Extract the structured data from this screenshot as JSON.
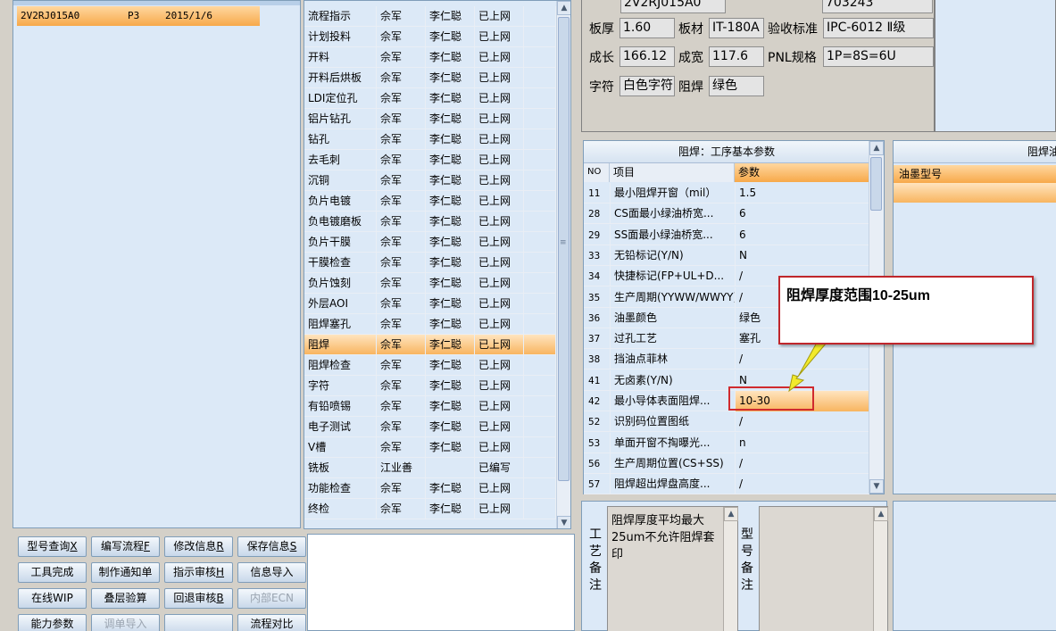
{
  "left_panel": {
    "row": {
      "code": "2V2RJ015A0",
      "col2": "P3",
      "date": "2015/1/6"
    }
  },
  "buttons": [
    {
      "label": "型号查询",
      "key": "X",
      "enabled": true
    },
    {
      "label": "编写流程",
      "key": "F",
      "enabled": true
    },
    {
      "label": "修改信息",
      "key": "R",
      "enabled": true
    },
    {
      "label": "保存信息",
      "key": "S",
      "enabled": true
    },
    {
      "label": "工具完成",
      "key": "",
      "enabled": true
    },
    {
      "label": "制作通知单",
      "key": "",
      "enabled": true
    },
    {
      "label": "指示审核",
      "key": "H",
      "enabled": true
    },
    {
      "label": "信息导入",
      "key": "",
      "enabled": true
    },
    {
      "label": "在线WIP",
      "key": "",
      "enabled": true
    },
    {
      "label": "叠层验算",
      "key": "",
      "enabled": true
    },
    {
      "label": "回退审核",
      "key": "B",
      "enabled": true
    },
    {
      "label": "内部ECN",
      "key": "",
      "enabled": false
    },
    {
      "label": "能力参数",
      "key": "",
      "enabled": true
    },
    {
      "label": "调单导入",
      "key": "",
      "enabled": false
    },
    {
      "label": "",
      "key": "",
      "enabled": true
    },
    {
      "label": "流程对比",
      "key": "",
      "enabled": true
    }
  ],
  "process_list": {
    "rows": [
      {
        "step": "流程指示",
        "c2": "佘军",
        "c3": "李仁聪",
        "c4": "已上网"
      },
      {
        "step": "计划投料",
        "c2": "佘军",
        "c3": "李仁聪",
        "c4": "已上网"
      },
      {
        "step": "开料",
        "c2": "佘军",
        "c3": "李仁聪",
        "c4": "已上网"
      },
      {
        "step": "开料后烘板",
        "c2": "佘军",
        "c3": "李仁聪",
        "c4": "已上网"
      },
      {
        "step": "LDI定位孔",
        "c2": "佘军",
        "c3": "李仁聪",
        "c4": "已上网"
      },
      {
        "step": "铝片钻孔",
        "c2": "佘军",
        "c3": "李仁聪",
        "c4": "已上网"
      },
      {
        "step": "钻孔",
        "c2": "佘军",
        "c3": "李仁聪",
        "c4": "已上网"
      },
      {
        "step": "去毛刺",
        "c2": "佘军",
        "c3": "李仁聪",
        "c4": "已上网"
      },
      {
        "step": "沉铜",
        "c2": "佘军",
        "c3": "李仁聪",
        "c4": "已上网"
      },
      {
        "step": "负片电镀",
        "c2": "佘军",
        "c3": "李仁聪",
        "c4": "已上网"
      },
      {
        "step": "负电镀磨板",
        "c2": "佘军",
        "c3": "李仁聪",
        "c4": "已上网"
      },
      {
        "step": "负片干膜",
        "c2": "佘军",
        "c3": "李仁聪",
        "c4": "已上网"
      },
      {
        "step": "干膜检查",
        "c2": "佘军",
        "c3": "李仁聪",
        "c4": "已上网"
      },
      {
        "step": "负片蚀刻",
        "c2": "佘军",
        "c3": "李仁聪",
        "c4": "已上网"
      },
      {
        "step": "外层AOI",
        "c2": "佘军",
        "c3": "李仁聪",
        "c4": "已上网"
      },
      {
        "step": "阻焊塞孔",
        "c2": "佘军",
        "c3": "李仁聪",
        "c4": "已上网"
      },
      {
        "step": "阻焊",
        "c2": "佘军",
        "c3": "李仁聪",
        "c4": "已上网",
        "selected": true
      },
      {
        "step": "阻焊检查",
        "c2": "佘军",
        "c3": "李仁聪",
        "c4": "已上网"
      },
      {
        "step": "字符",
        "c2": "佘军",
        "c3": "李仁聪",
        "c4": "已上网"
      },
      {
        "step": "有铅喷锡",
        "c2": "佘军",
        "c3": "李仁聪",
        "c4": "已上网"
      },
      {
        "step": "电子测试",
        "c2": "佘军",
        "c3": "李仁聪",
        "c4": "已上网"
      },
      {
        "step": "V槽",
        "c2": "佘军",
        "c3": "李仁聪",
        "c4": "已上网"
      },
      {
        "step": "铣板",
        "c2": "江业善",
        "c3": "",
        "c4": "已编写"
      },
      {
        "step": "功能检查",
        "c2": "佘军",
        "c3": "李仁聪",
        "c4": "已上网"
      },
      {
        "step": "终检",
        "c2": "佘军",
        "c3": "李仁聪",
        "c4": "已上网"
      }
    ]
  },
  "info": {
    "top_value": "2V2RJ015A0",
    "top_value2": "703243",
    "thickness_label": "板厚",
    "thickness": "1.60",
    "material_label": "板材",
    "material": "IT-180A",
    "standard_label": "验收标准",
    "standard": "IPC-6012 Ⅱ级",
    "length_label": "成长",
    "length": "166.12",
    "width_label": "成宽",
    "width": "117.6",
    "pnl_label": "PNL规格",
    "pnl": "1P=8S=6U",
    "char_label": "字符",
    "char_color": "白色字符",
    "mask_label": "阻焊",
    "mask_color": "绿色"
  },
  "params": {
    "title": "阻焊：工序基本参数",
    "headers": {
      "no": "NO",
      "item": "项目",
      "value": "参数"
    },
    "rows": [
      {
        "no": "11",
        "item": "最小阻焊开窗（mil）",
        "value": "1.5"
      },
      {
        "no": "28",
        "item": "CS面最小绿油桥宽...",
        "value": "6"
      },
      {
        "no": "29",
        "item": "SS面最小绿油桥宽...",
        "value": "6"
      },
      {
        "no": "33",
        "item": "无铅标记(Y/N)",
        "value": "N"
      },
      {
        "no": "34",
        "item": "快捷标记(FP+UL+D...",
        "value": "/"
      },
      {
        "no": "35",
        "item": "生产周期(YYWW/WWYY)",
        "value": "/"
      },
      {
        "no": "36",
        "item": "油墨颜色",
        "value": "绿色"
      },
      {
        "no": "37",
        "item": "过孔工艺",
        "value": "塞孔"
      },
      {
        "no": "38",
        "item": "挡油点菲林",
        "value": "/"
      },
      {
        "no": "41",
        "item": "无卤素(Y/N)",
        "value": "N"
      },
      {
        "no": "42",
        "item": "最小导体表面阻焊...",
        "value": "10-30",
        "selected": true
      },
      {
        "no": "52",
        "item": "识别码位置图纸",
        "value": "/"
      },
      {
        "no": "53",
        "item": "单面开窗不掏曝光...",
        "value": "n"
      },
      {
        "no": "56",
        "item": "生产周期位置(CS+SS)",
        "value": "/"
      },
      {
        "no": "57",
        "item": "阻焊超出焊盘高度...",
        "value": "/"
      }
    ]
  },
  "right_grid": {
    "title": "阻焊油",
    "header": "油墨型号"
  },
  "remarks": {
    "process_label": "工艺备注",
    "process_text": "阻焊厚度平均最大25um不允许阻焊套印",
    "model_label": "型号备注"
  },
  "callout": {
    "text": "阻焊厚度范围10-25um"
  },
  "colors": {
    "highlight_red": "#d02a2e",
    "arrow_yellow": "#f2ea2c",
    "selected_orange": "#f8b560"
  }
}
